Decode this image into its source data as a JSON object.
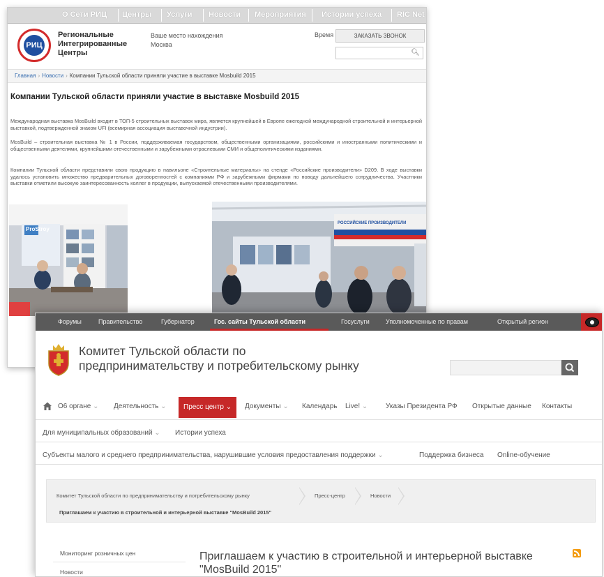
{
  "ric": {
    "topnav": [
      "О Сети РИЦ",
      "Центры",
      "Услуги",
      "Новости",
      "Мероприятия",
      "Истории успеха",
      "RIC Net"
    ],
    "logo_text": "РИЦ",
    "brand_line1": "Региональные",
    "brand_line2": "Интегрированные",
    "brand_line3": "Центры",
    "location_label": "Ваше место нахождения",
    "location_value": "Москва",
    "time_label": "Время",
    "call_button": "ЗАКАЗАТЬ ЗВОНОК",
    "search_icon": "magnifier-icon",
    "breadcrumbs": [
      "Главная",
      "Новости",
      "Компании Тульской области приняли участие в выставке Mosbuild 2015"
    ],
    "article_title": "Компании Тульской области приняли участие в выставке Mosbuild 2015",
    "paragraphs": [
      "Международная выставка MosBuild входит в ТОП-5 строительных выставок мира, является крупнейшей в Европе ежегодной международной строительной и интерьерной выставкой, подтвержденной знаком UFI (всемирная ассоциация выставочной индустрии).",
      "MosBuild – строительная выставка № 1 в России, поддерживаемая государством, общественными организациями, российскими и иностранными политическими и общественными деятелями, крупнейшими отечественными и зарубежными отраслевыми СМИ и общеполитическими изданиями.",
      "Компании Тульской области представили свою продукцию в павильоне «Строительные материалы» на стенде «Российские производители» D209. В ходе выставки удалось установить множество предварительных договоренностей с компаниями РФ и зарубежными фирмами по поводу дальнейшего сотрудничества. Участники выставки отметили высокую заинтересованность коллег в продукции, выпускаемой отечественными производителями."
    ],
    "photo1_sign": "ProStroy",
    "photo2_sign": "РОССИЙСКИЕ ПРОИЗВОДИТЕЛИ"
  },
  "committee": {
    "gos_links": [
      "Форумы",
      "Правительство",
      "Губернатор",
      "Гос. сайты Тульской области",
      "Госуслуги",
      "Уполномоченные по правам",
      "Открытый регион"
    ],
    "eye_icon": "eye-icon",
    "title": "Комитет Тульской области по предпринимательству и потребительскому рынку",
    "search_icon": "search-icon",
    "menu": [
      "О6 органе",
      "Деятельность",
      "Пресс центр",
      "Документы",
      "Календарь",
      "Live!",
      "Указы Президента РФ",
      "Открытые данные",
      "Контакты"
    ],
    "menu2": [
      "Для муниципальных образований",
      "Истории успеха"
    ],
    "menu3": [
      "Субъекты малого и среднего предпринимательства, нарушившие условия предоставления поддержки",
      "Поддержка бизнеса",
      "Online-обучение"
    ],
    "breadcrumbs": [
      "Комитет Тульской области по предпринимательству и потребительскому рынку",
      "Пресс-центр",
      "Новости"
    ],
    "breadcrumb_current": "Приглашаем к участию в строительной и интерьерной выставке \"MosBuild 2015\"",
    "sidebar": [
      "Мониторинг розничных цен",
      "Новости"
    ],
    "page_title": "Приглашаем к участию в строительной и интерьерной выставке \"MosBuild 2015\"",
    "colors": {
      "accent": "#c62828",
      "gosbar": "#5a5a5a",
      "brand_blue": "#1f4fa0"
    }
  }
}
